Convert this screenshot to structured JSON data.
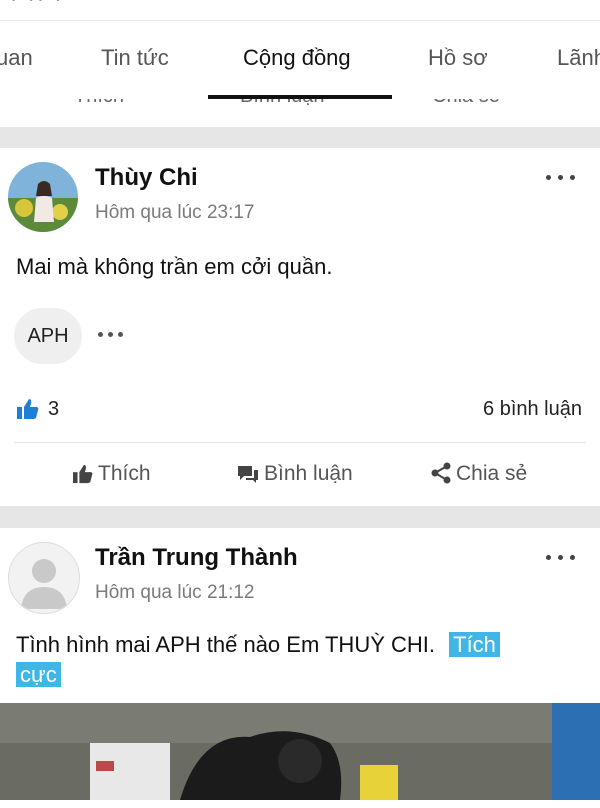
{
  "tabs": [
    {
      "label": "uan",
      "active": false
    },
    {
      "label": "Tin tức",
      "active": false
    },
    {
      "label": "Cộng đồng",
      "active": true
    },
    {
      "label": "Hồ sơ",
      "active": false
    },
    {
      "label": "Lãnh",
      "active": false
    }
  ],
  "top_strip_text": "· ·· ·",
  "prev_post_actions": {
    "like": "Thích",
    "comment": "Bình luận",
    "share": "Chia sẻ"
  },
  "posts": [
    {
      "author": "Thùy Chi",
      "time": "Hôm qua lúc 23:17",
      "text": "Mai mà không trần em cởi quần.",
      "tag": "APH",
      "like_count": "3",
      "comment_count": "6 bình luận",
      "actions": {
        "like": "Thích",
        "comment": "Bình luận",
        "share": "Chia sẻ"
      }
    },
    {
      "author": "Trần Trung Thành",
      "time": "Hôm qua lúc 21:12",
      "text": "Tình hình mai APH thế nào Em THUỲ CHI.",
      "highlight_line1": "Tích",
      "highlight_line2": "cực"
    }
  ],
  "colors": {
    "accent": "#1f7fd6",
    "highlight": "#3fb6e6"
  }
}
